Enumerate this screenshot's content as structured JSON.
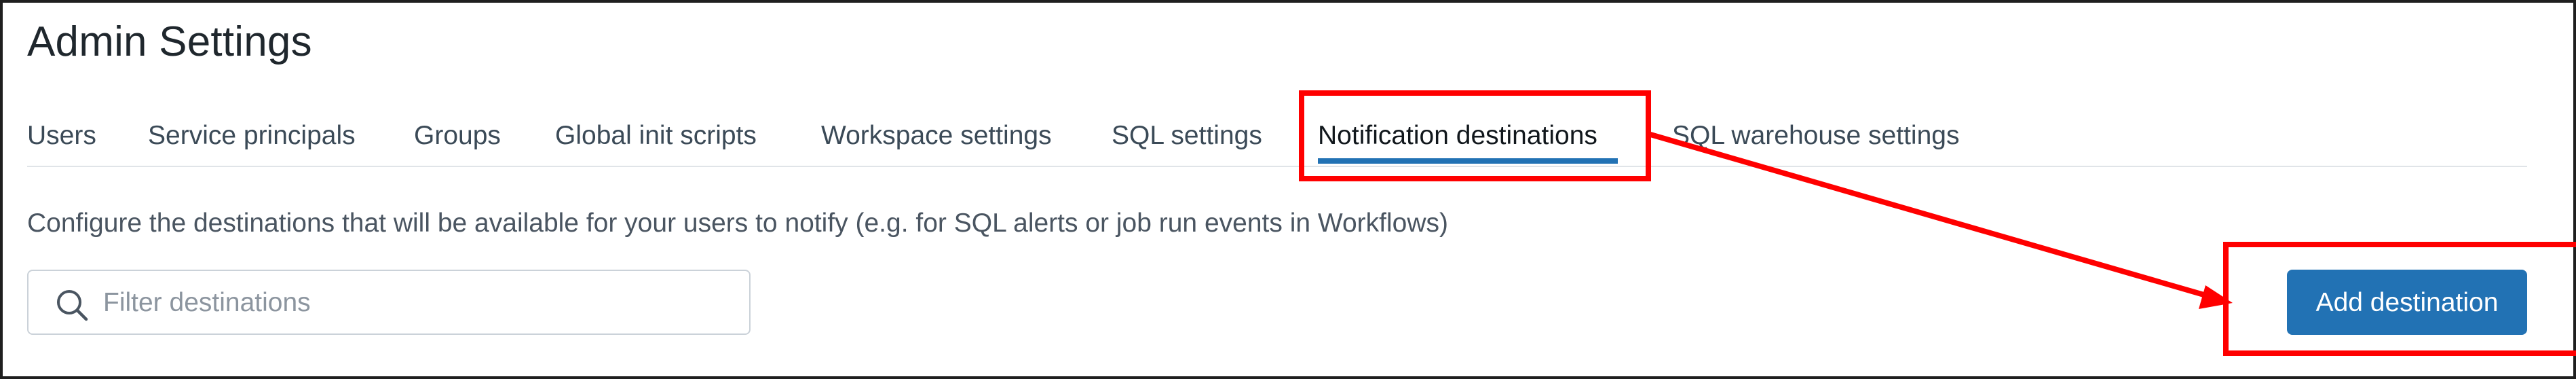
{
  "page": {
    "title": "Admin Settings"
  },
  "tabs": [
    {
      "label": "Users",
      "active": false
    },
    {
      "label": "Service principals",
      "active": false
    },
    {
      "label": "Groups",
      "active": false
    },
    {
      "label": "Global init scripts",
      "active": false
    },
    {
      "label": "Workspace settings",
      "active": false
    },
    {
      "label": "SQL settings",
      "active": false
    },
    {
      "label": "Notification destinations",
      "active": true
    },
    {
      "label": "SQL warehouse settings",
      "active": false
    }
  ],
  "content": {
    "description": "Configure the destinations that will be available for your users to notify (e.g. for SQL alerts or job run events in Workflows)",
    "search": {
      "placeholder": "Filter destinations",
      "value": "",
      "icon": "search-icon"
    },
    "add_button_label": "Add destination"
  },
  "colors": {
    "accent": "#2272b4",
    "annotation": "#ff0000",
    "title_text": "#1f272d",
    "tab_text": "#3b4a57",
    "muted_text": "#4a5561",
    "placeholder_text": "#8c959f"
  }
}
